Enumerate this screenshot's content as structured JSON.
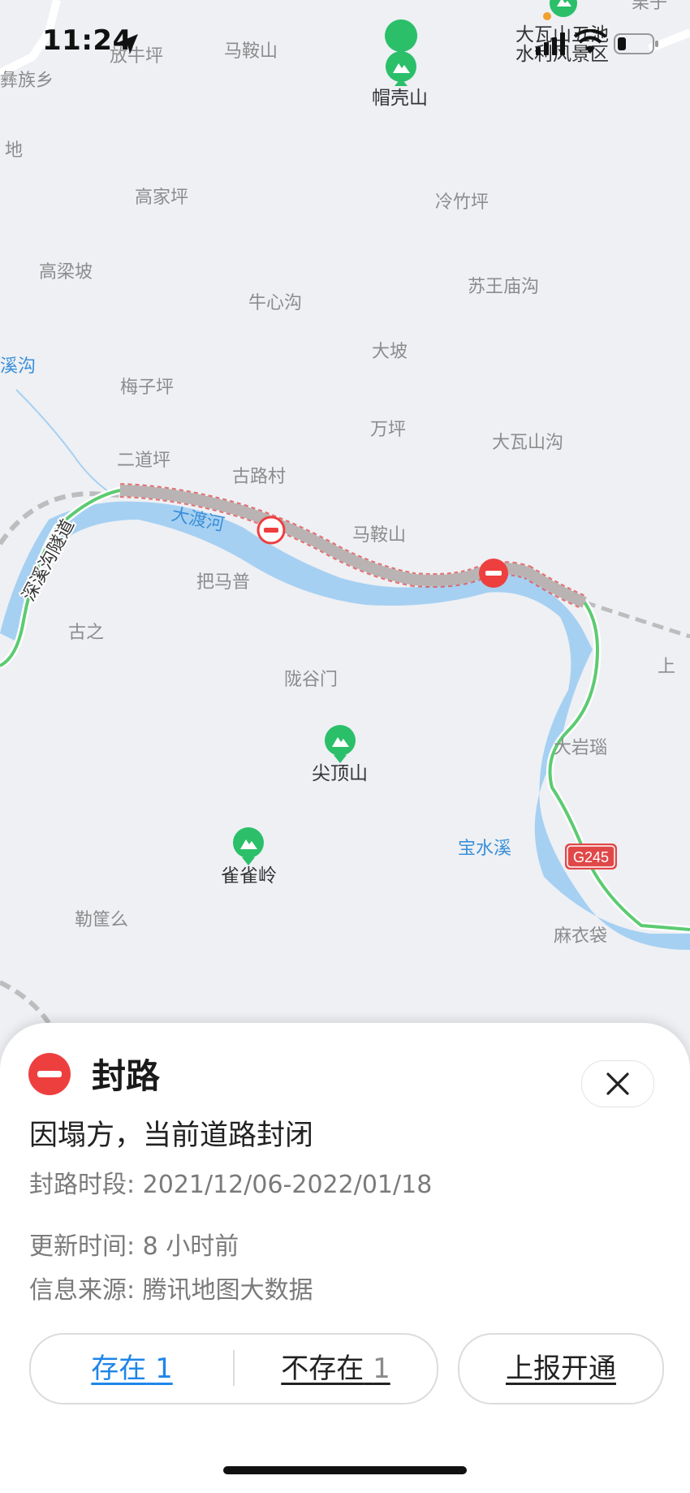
{
  "status_bar": {
    "time": "11:24"
  },
  "map": {
    "place_labels": [
      {
        "text": "放牛坪",
        "color": "#8c8c8c"
      },
      {
        "text": "马鞍山",
        "color": "#8c8c8c"
      },
      {
        "text": "帽壳山",
        "color": "#333333"
      },
      {
        "text": "大瓦山五池",
        "color": "#333333"
      },
      {
        "text": "水利风景区",
        "color": "#333333"
      },
      {
        "text": "栗子",
        "color": "#8c8c8c"
      },
      {
        "text": "彝族乡",
        "color": "#8c8c8c"
      },
      {
        "text": "地",
        "color": "#8c8c8c"
      },
      {
        "text": "高家坪",
        "color": "#8c8c8c"
      },
      {
        "text": "冷竹坪",
        "color": "#8c8c8c"
      },
      {
        "text": "高梁坡",
        "color": "#8c8c8c"
      },
      {
        "text": "苏王庙沟",
        "color": "#8c8c8c"
      },
      {
        "text": "牛心沟",
        "color": "#8c8c8c"
      },
      {
        "text": "溪沟",
        "color": "#3a8fd8"
      },
      {
        "text": "大坡",
        "color": "#8c8c8c"
      },
      {
        "text": "梅子坪",
        "color": "#8c8c8c"
      },
      {
        "text": "万坪",
        "color": "#8c8c8c"
      },
      {
        "text": "大瓦山沟",
        "color": "#8c8c8c"
      },
      {
        "text": "二道坪",
        "color": "#8c8c8c"
      },
      {
        "text": "古路村",
        "color": "#8c8c8c"
      },
      {
        "text": "大渡河",
        "color": "#3a8fd8"
      },
      {
        "text": "马鞍山",
        "color": "#8c8c8c"
      },
      {
        "text": "把马普",
        "color": "#8c8c8c"
      },
      {
        "text": "古之",
        "color": "#8c8c8c"
      },
      {
        "text": "上",
        "color": "#8c8c8c"
      },
      {
        "text": "陇谷门",
        "color": "#8c8c8c"
      },
      {
        "text": "大岩瑙",
        "color": "#8c8c8c"
      },
      {
        "text": "尖顶山",
        "color": "#333333"
      },
      {
        "text": "宝水溪",
        "color": "#3a8fd8"
      },
      {
        "text": "雀雀岭",
        "color": "#333333"
      },
      {
        "text": "勒筐么",
        "color": "#8c8c8c"
      },
      {
        "text": "麻衣袋",
        "color": "#8c8c8c"
      }
    ],
    "tunnel_label": "深溪沟隧道",
    "road_shield": "G245",
    "colors": {
      "water": "#a6d0f2",
      "green_route": "#5ccb71",
      "closed_road": "#b9b3b3",
      "closed_border": "#e05c5c",
      "poi_green": "#2bbf6a",
      "closure_red": "#ee3f3f"
    },
    "icons": [
      "mountain-poi-icon",
      "road-closed-icon",
      "railway-line"
    ]
  },
  "sheet": {
    "icon": "road-closed-icon",
    "title": "封路",
    "description": "因塌方，当前道路封闭",
    "period": "封路时段: 2021/12/06-2022/01/18",
    "updated": "更新时间: 8 小时前",
    "source": "信息来源: 腾讯地图大数据",
    "close_icon": "close-icon",
    "vote": {
      "exist_label": "存在",
      "exist_count": "1",
      "not_exist_label": "不存在",
      "not_exist_count": "1"
    },
    "report_label": "上报开通"
  }
}
